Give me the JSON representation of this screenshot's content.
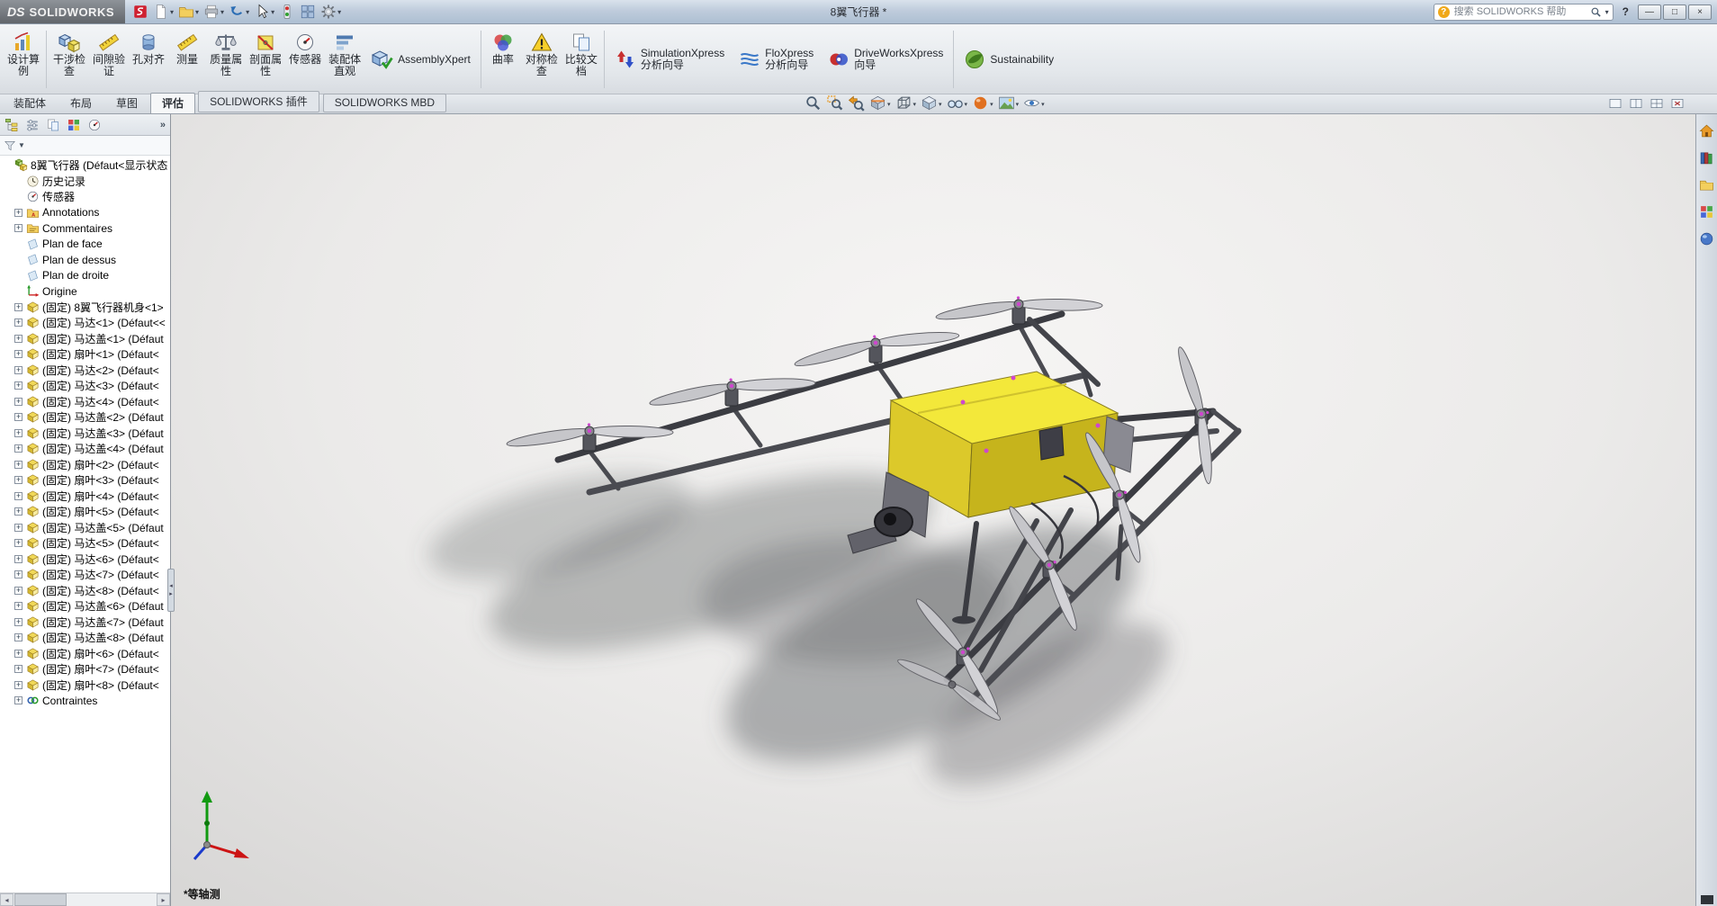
{
  "window": {
    "logo_prefix": "DS",
    "logo_text": "SOLIDWORKS",
    "title": "8翼飞行器 *",
    "search_placeholder": "搜索 SOLIDWORKS 帮助",
    "help_label": "?",
    "controls": [
      {
        "name": "minimize",
        "glyph": "—"
      },
      {
        "name": "maximize",
        "glyph": "□"
      },
      {
        "name": "close",
        "glyph": "×"
      }
    ]
  },
  "quick_toolbar": [
    {
      "name": "app",
      "icon": "sw-app",
      "dropdown": false
    },
    {
      "name": "new-document",
      "icon": "page",
      "dropdown": true
    },
    {
      "name": "open-document",
      "icon": "folder",
      "dropdown": true
    },
    {
      "name": "print",
      "icon": "printer",
      "dropdown": true
    },
    {
      "name": "undo",
      "icon": "undo",
      "dropdown": true
    },
    {
      "name": "select",
      "icon": "cursor",
      "dropdown": true
    },
    {
      "name": "rebuild",
      "icon": "traffic",
      "dropdown": false
    },
    {
      "name": "file-properties",
      "icon": "grid",
      "dropdown": false
    },
    {
      "name": "options",
      "icon": "gear",
      "dropdown": true
    }
  ],
  "ribbon": [
    {
      "label": "设计算\n例",
      "icon": "study",
      "name": "design-study"
    },
    {
      "sep": true
    },
    {
      "label": "干涉检\n查",
      "icon": "cubes-blue",
      "name": "interference-check"
    },
    {
      "label": "间隙验\n证",
      "icon": "ruler",
      "name": "clearance-verification"
    },
    {
      "label": "孔对齐",
      "icon": "cyl",
      "name": "hole-alignment"
    },
    {
      "label": "测量",
      "icon": "ruler",
      "name": "measure"
    },
    {
      "label": "质量属\n性",
      "icon": "scale",
      "name": "mass-properties"
    },
    {
      "label": "剖面属\n性",
      "icon": "sectionp",
      "name": "section-properties"
    },
    {
      "label": "传感器",
      "icon": "gauge",
      "name": "sensor"
    },
    {
      "label": "装配体\n直观",
      "icon": "vis",
      "name": "assembly-visualization"
    },
    {
      "label": "AssemblyXpert",
      "icon": "xpert",
      "name": "assemblyxpert",
      "h": true
    },
    {
      "sep": true
    },
    {
      "label": "曲率",
      "icon": "rainbow",
      "name": "curvature"
    },
    {
      "label": "对称检\n查",
      "icon": "warn",
      "name": "symmetry-check"
    },
    {
      "label": "比较文\n档",
      "icon": "docs2",
      "name": "compare-documents"
    },
    {
      "sep": true
    },
    {
      "label": "SimulationXpress\n分析向导",
      "icon": "simx",
      "name": "simulationxpress-wizard",
      "h": true
    },
    {
      "label": "FloXpress\n分析向导",
      "icon": "flox",
      "name": "floxpress-wizard",
      "h": true
    },
    {
      "label": "DriveWorksXpress\n向导",
      "icon": "drivex",
      "name": "driveworksxpress-wizard",
      "h": true
    },
    {
      "sep": true
    },
    {
      "label": "Sustainability",
      "icon": "leaf",
      "name": "sustainability",
      "h": true
    }
  ],
  "tabs": [
    {
      "label": "装配体",
      "active": false,
      "boxed": false
    },
    {
      "label": "布局",
      "active": false,
      "boxed": false
    },
    {
      "label": "草图",
      "active": false,
      "boxed": false
    },
    {
      "label": "评估",
      "active": true,
      "boxed": false
    },
    {
      "label": "SOLIDWORKS 插件",
      "active": false,
      "boxed": true
    },
    {
      "label": "SOLIDWORKS MBD",
      "active": false,
      "boxed": true
    }
  ],
  "headsup": [
    {
      "name": "zoom-fit",
      "icon": "maglass",
      "dropdown": false
    },
    {
      "name": "zoom-area",
      "icon": "magarea",
      "dropdown": false
    },
    {
      "name": "previous-view",
      "icon": "prevview",
      "dropdown": false
    },
    {
      "name": "section-view",
      "icon": "sectionv",
      "dropdown": true
    },
    {
      "name": "view-orientation",
      "icon": "orientcube",
      "dropdown": true
    },
    {
      "name": "display-style",
      "icon": "dispstyle",
      "dropdown": true
    },
    {
      "name": "hide-show-items",
      "icon": "glasses",
      "dropdown": true
    },
    {
      "name": "edit-appearance",
      "icon": "ball",
      "dropdown": true
    },
    {
      "name": "apply-scene",
      "icon": "scene",
      "dropdown": true
    },
    {
      "name": "view-settings",
      "icon": "viewset",
      "dropdown": true
    }
  ],
  "window_layout_buttons": [
    {
      "name": "viewport-single",
      "icon": "win1"
    },
    {
      "name": "viewport-two",
      "icon": "win2"
    },
    {
      "name": "viewport-four",
      "icon": "win4"
    },
    {
      "name": "close-group",
      "icon": "winx"
    }
  ],
  "feature_tree": {
    "header_icons": [
      {
        "name": "featuremanager-tab",
        "icon": "fm-tree"
      },
      {
        "name": "propertymanager-tab",
        "icon": "fm-prop"
      },
      {
        "name": "configurationmanager-tab",
        "icon": "config"
      },
      {
        "name": "displaymanager-tab",
        "icon": "display"
      },
      {
        "name": "dimxpertmanager-tab",
        "icon": "dimxpert"
      }
    ],
    "expand_label": "»",
    "filter_caret": "▼",
    "items": [
      {
        "label": "8翼飞行器 (Défaut<显示状态",
        "icon": "assembly",
        "expandable": false,
        "root": true
      },
      {
        "label": "历史记录",
        "icon": "history",
        "expandable": false
      },
      {
        "label": "传感器",
        "icon": "sensors",
        "expandable": false
      },
      {
        "label": "Annotations",
        "icon": "folder-a",
        "expandable": true
      },
      {
        "label": "Commentaires",
        "icon": "folder-c",
        "expandable": true
      },
      {
        "label": "Plan de face",
        "icon": "plane",
        "expandable": false
      },
      {
        "label": "Plan de dessus",
        "icon": "plane",
        "expandable": false
      },
      {
        "label": "Plan de droite",
        "icon": "plane",
        "expandable": false
      },
      {
        "label": "Origine",
        "icon": "origin",
        "expandable": false
      },
      {
        "label": "(固定) 8翼飞行器机身<1>",
        "icon": "part",
        "expandable": true
      },
      {
        "label": "(固定) 马达<1> (Défaut<<",
        "icon": "part",
        "expandable": true
      },
      {
        "label": "(固定) 马达盖<1> (Défaut",
        "icon": "part",
        "expandable": true
      },
      {
        "label": "(固定) 扇叶<1> (Défaut<",
        "icon": "part",
        "expandable": true
      },
      {
        "label": "(固定) 马达<2> (Défaut<",
        "icon": "part",
        "expandable": true
      },
      {
        "label": "(固定) 马达<3> (Défaut<",
        "icon": "part",
        "expandable": true
      },
      {
        "label": "(固定) 马达<4> (Défaut<",
        "icon": "part",
        "expandable": true
      },
      {
        "label": "(固定) 马达盖<2> (Défaut",
        "icon": "part",
        "expandable": true
      },
      {
        "label": "(固定) 马达盖<3> (Défaut",
        "icon": "part",
        "expandable": true
      },
      {
        "label": "(固定) 马达盖<4> (Défaut",
        "icon": "part",
        "expandable": true
      },
      {
        "label": "(固定) 扇叶<2> (Défaut<",
        "icon": "part",
        "expandable": true
      },
      {
        "label": "(固定) 扇叶<3> (Défaut<",
        "icon": "part",
        "expandable": true
      },
      {
        "label": "(固定) 扇叶<4> (Défaut<",
        "icon": "part",
        "expandable": true
      },
      {
        "label": "(固定) 扇叶<5> (Défaut<",
        "icon": "part",
        "expandable": true
      },
      {
        "label": "(固定) 马达盖<5> (Défaut",
        "icon": "part",
        "expandable": true
      },
      {
        "label": "(固定) 马达<5> (Défaut<",
        "icon": "part",
        "expandable": true
      },
      {
        "label": "(固定) 马达<6> (Défaut<",
        "icon": "part",
        "expandable": true
      },
      {
        "label": "(固定) 马达<7> (Défaut<",
        "icon": "part",
        "expandable": true
      },
      {
        "label": "(固定) 马达<8> (Défaut<",
        "icon": "part",
        "expandable": true
      },
      {
        "label": "(固定) 马达盖<6> (Défaut",
        "icon": "part",
        "expandable": true
      },
      {
        "label": "(固定) 马达盖<7> (Défaut",
        "icon": "part",
        "expandable": true
      },
      {
        "label": "(固定) 马达盖<8> (Défaut",
        "icon": "part",
        "expandable": true
      },
      {
        "label": "(固定) 扇叶<6> (Défaut<",
        "icon": "part",
        "expandable": true
      },
      {
        "label": "(固定) 扇叶<7> (Défaut<",
        "icon": "part",
        "expandable": true
      },
      {
        "label": "(固定) 扇叶<8> (Défaut<",
        "icon": "part",
        "expandable": true
      },
      {
        "label": "Contraintes",
        "icon": "mates",
        "expandable": true
      }
    ]
  },
  "taskpane": [
    {
      "name": "solidworks-resources",
      "icon": "home"
    },
    {
      "name": "design-library",
      "icon": "books"
    },
    {
      "name": "file-explorer",
      "icon": "file-explorer"
    },
    {
      "name": "view-palette",
      "icon": "display"
    },
    {
      "name": "appearances-scenes",
      "icon": "sphere-blue"
    }
  ],
  "viewport": {
    "view_label": "*等轴测"
  },
  "colors": {
    "body_yellow": "#f3e83a",
    "frame_gray": "#3b3c42",
    "mate_magenta": "#cf46cf",
    "titlebar_blue": "#bfccdc"
  }
}
